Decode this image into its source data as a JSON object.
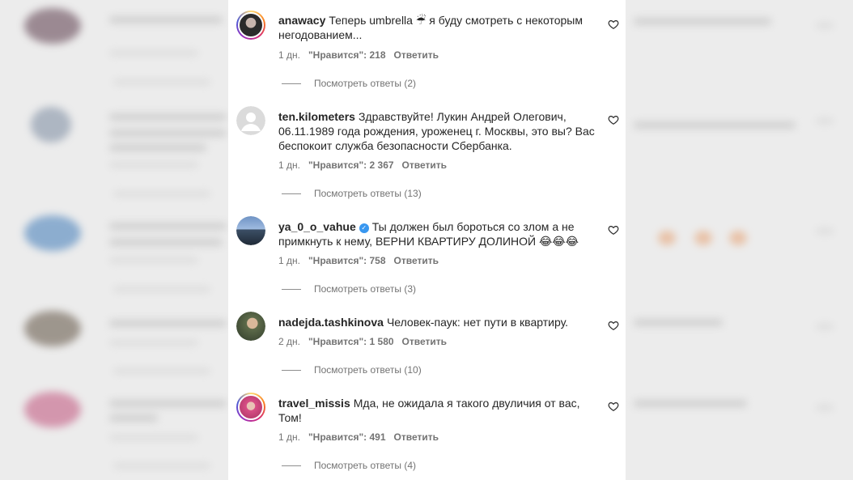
{
  "comments": [
    {
      "username": "anawacy",
      "text": "Теперь umbrella ☔ я буду смотреть с некоторым негодованием...",
      "time": "1 дн.",
      "likes": "\"Нравится\": 218",
      "reply": "Ответить",
      "view_replies": "Посмотреть ответы (2)",
      "verified": false
    },
    {
      "username": "ten.kilometers",
      "text": "Здравствуйте! Лукин Андрей Олегович, 06.11.1989 года рождения, уроженец г. Москвы, это вы? Вас беспокоит служба безопасности Сбербанка.",
      "time": "1 дн.",
      "likes": "\"Нравится\": 2 367",
      "reply": "Ответить",
      "view_replies": "Посмотреть ответы (13)",
      "verified": false
    },
    {
      "username": "ya_0_o_vahue",
      "text": "Ты должен был бороться со злом а не примкнуть к нему, ВЕРНИ КВАРТИРУ ДОЛИНОЙ 😂😂😂",
      "time": "1 дн.",
      "likes": "\"Нравится\": 758",
      "reply": "Ответить",
      "view_replies": "Посмотреть ответы (3)",
      "verified": true
    },
    {
      "username": "nadejda.tashkinova",
      "text": "Человек-паук: нет пути в квартиру.",
      "time": "2 дн.",
      "likes": "\"Нравится\": 1 580",
      "reply": "Ответить",
      "view_replies": "Посмотреть ответы (10)",
      "verified": false
    },
    {
      "username": "travel_missis",
      "text": "Мда, не ожидала я такого двуличия от вас, Том!",
      "time": "1 дн.",
      "likes": "\"Нравится\": 491",
      "reply": "Ответить",
      "view_replies": "Посмотреть ответы (4)",
      "verified": false
    }
  ],
  "icons": {
    "like": "heart-outline-icon",
    "verified": "verified-badge-icon"
  },
  "colors": {
    "text": "#262626",
    "secondary": "#737373",
    "verified": "#3897f0",
    "panel_bg": "#ffffff"
  }
}
